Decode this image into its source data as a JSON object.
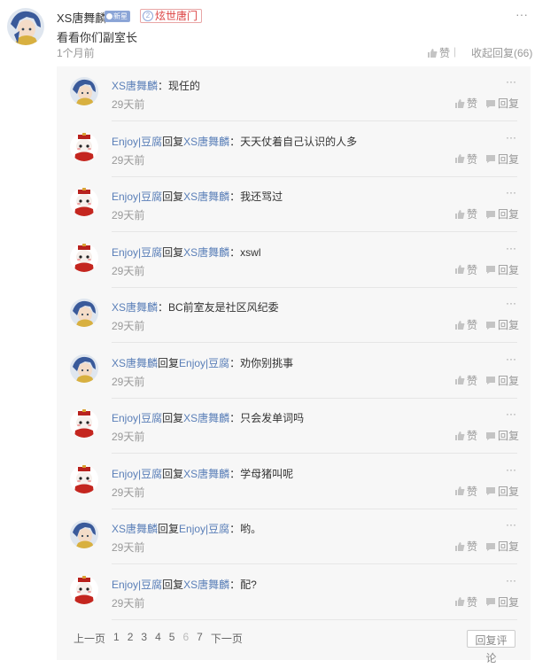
{
  "main_comment": {
    "author": "XS唐舞麟",
    "new_badge": "新星",
    "fan_badge_level": "2",
    "fan_badge": "炫世唐门",
    "text": "看看你们副室长",
    "time": "1个月前",
    "more": "···",
    "like_label": "赞",
    "separator": "|",
    "fold_label": "收起回复(66)"
  },
  "replies": [
    {
      "avatar": "blue-hair-avatar",
      "author": "XS唐舞麟",
      "reply_word": "",
      "target": "",
      "text": "：现任的",
      "time": "29天前"
    },
    {
      "avatar": "red-hat-avatar",
      "author": "Enjoy|豆腐",
      "reply_word": "回复",
      "target": "XS唐舞麟",
      "text": "：天天仗着自己认识的人多",
      "time": "29天前"
    },
    {
      "avatar": "red-hat-avatar",
      "author": "Enjoy|豆腐",
      "reply_word": "回复",
      "target": "XS唐舞麟",
      "text": "：我还骂过",
      "time": "29天前"
    },
    {
      "avatar": "red-hat-avatar",
      "author": "Enjoy|豆腐",
      "reply_word": "回复",
      "target": "XS唐舞麟",
      "text": "：xswl",
      "time": "29天前"
    },
    {
      "avatar": "blue-hair-avatar",
      "author": "XS唐舞麟",
      "reply_word": "",
      "target": "",
      "text": "：BC前室友是社区风纪委",
      "time": "29天前"
    },
    {
      "avatar": "blue-hair-avatar",
      "author": "XS唐舞麟",
      "reply_word": "回复",
      "target": "Enjoy|豆腐",
      "text": "：劝你别挑事",
      "time": "29天前"
    },
    {
      "avatar": "red-hat-avatar",
      "author": "Enjoy|豆腐",
      "reply_word": "回复",
      "target": "XS唐舞麟",
      "text": "：只会发单词吗",
      "time": "29天前"
    },
    {
      "avatar": "red-hat-avatar",
      "author": "Enjoy|豆腐",
      "reply_word": "回复",
      "target": "XS唐舞麟",
      "text": "：学母猪叫呢",
      "time": "29天前"
    },
    {
      "avatar": "blue-hair-avatar",
      "author": "XS唐舞麟",
      "reply_word": "回复",
      "target": "Enjoy|豆腐",
      "text": "：哟。",
      "time": "29天前"
    },
    {
      "avatar": "red-hat-avatar",
      "author": "Enjoy|豆腐",
      "reply_word": "回复",
      "target": "XS唐舞麟",
      "text": "：配?",
      "time": "29天前"
    }
  ],
  "reply_actions": {
    "like_label": "赞",
    "reply_label": "回复",
    "more": "···"
  },
  "pager": {
    "prev": "上一页",
    "pages": [
      "1",
      "2",
      "3",
      "4",
      "5",
      "6",
      "7"
    ],
    "current": "6",
    "next": "下一页",
    "reply_comment": "回复评论"
  }
}
